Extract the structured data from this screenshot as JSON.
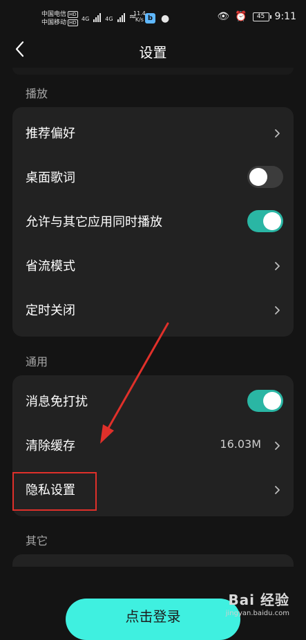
{
  "status_bar": {
    "carrier1": "中国电信",
    "carrier2": "中国移动",
    "hd": "HD",
    "net1": "4G",
    "net2": "4G",
    "speed_value": "11.4",
    "speed_unit": "K/s",
    "battery": "45",
    "time": "9:11"
  },
  "header": {
    "title": "设置"
  },
  "sections": {
    "playback": {
      "label": "播放",
      "items": [
        {
          "label": "推荐偏好",
          "control": "chevron"
        },
        {
          "label": "桌面歌词",
          "control": "toggle",
          "on": false
        },
        {
          "label": "允许与其它应用同时播放",
          "control": "toggle",
          "on": true
        },
        {
          "label": "省流模式",
          "control": "chevron"
        },
        {
          "label": "定时关闭",
          "control": "chevron"
        }
      ]
    },
    "general": {
      "label": "通用",
      "items": [
        {
          "label": "消息免打扰",
          "control": "toggle",
          "on": true
        },
        {
          "label": "清除缓存",
          "value": "16.03M",
          "control": "chevron"
        },
        {
          "label": "隐私设置",
          "control": "chevron"
        }
      ]
    },
    "other": {
      "label": "其它"
    }
  },
  "login_button": "点击登录",
  "watermark": {
    "main": "Bai 经验",
    "sub": "jingyan.baidu.com"
  },
  "colors": {
    "accent": "#2ab6a4",
    "login": "#3ff0e0",
    "highlight": "#e0302a"
  }
}
